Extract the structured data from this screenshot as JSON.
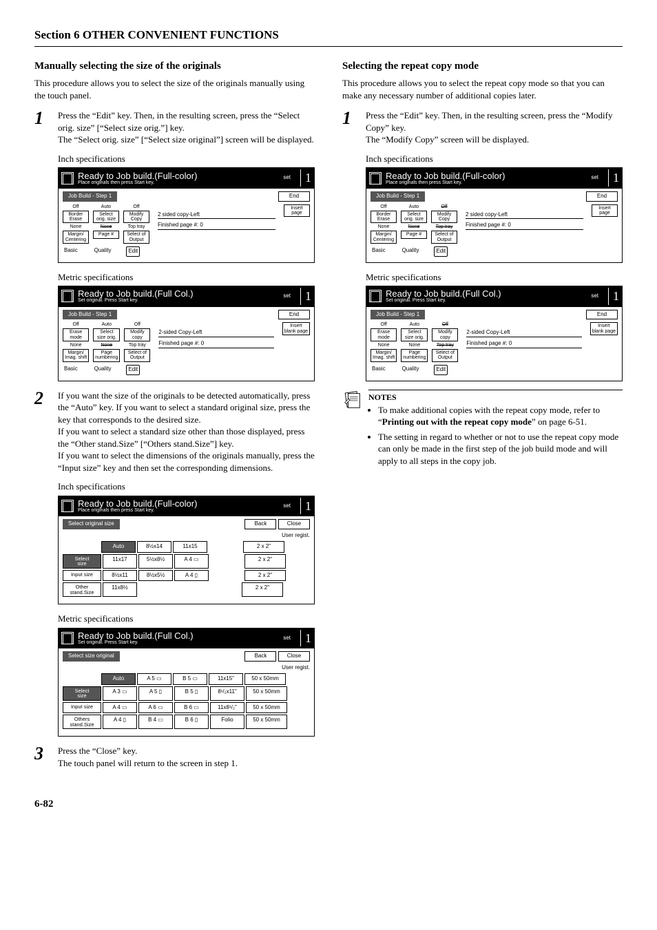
{
  "section_title": "Section 6  OTHER CONVENIENT FUNCTIONS",
  "page_number": "6-82",
  "speclabels": {
    "inch": "Inch specifications",
    "metric": "Metric specifications"
  },
  "panel_common": {
    "set": "set",
    "one": "1",
    "end": "End",
    "back": "Back",
    "close": "Close",
    "user_regist": "User regist."
  },
  "left": {
    "title": "Manually selecting the size of the originals",
    "intro": "This procedure allows you to select the size of the originals manually using the touch panel.",
    "step1": {
      "p1": "Press the “Edit” key. Then, in the resulting screen, press the “Select orig. size” [“Select size orig.”] key.",
      "p2": "The “Select orig. size” [“Select size original”] screen will be displayed."
    },
    "panel_inch": {
      "ready": "Ready to Job build.(Full-color)",
      "sub": "Place originals then press Start key.",
      "step": "Job Build -  Step 1",
      "insert": "Insert\npage",
      "status1": "2 sided copy-Left",
      "status2": "Finished page #: 0",
      "col1": {
        "v1": "Off",
        "b1": "Border\nErase",
        "v2": "None",
        "b2": "Margin/\nCentering"
      },
      "col2": {
        "v1": "Auto",
        "b1": "Select\norig. size",
        "v2": "None",
        "b2": "Page #"
      },
      "col3": {
        "v1": "Off",
        "b1": "Modify\nCopy",
        "v2": "Top tray",
        "b2": "Select of\nOutput"
      },
      "tabs": {
        "a": "Basic",
        "b": "Quality",
        "c": "Edit"
      }
    },
    "panel_metric": {
      "ready": "Ready to Job build.(Full Col.)",
      "sub": "Set original. Press Start key.",
      "step": "Job Build -  Step 1",
      "insert": "Insert\nblank page",
      "status1": "2-sided Copy-Left",
      "status2": "Finished page #: 0",
      "col1": {
        "v1": "Off",
        "b1": "Erase\nmode",
        "v2": "None",
        "b2": "Margin/\nImag. shift"
      },
      "col2": {
        "v1": "Auto",
        "b1": "Select\nsize orig.",
        "v2": "None",
        "b2": "Page\nnumbering"
      },
      "col3": {
        "v1": "Off",
        "b1": "Modify\ncopy",
        "v2": "Top tray",
        "b2": "Select of\nOutput"
      },
      "tabs": {
        "a": "Basic",
        "b": "Quality",
        "c": "Edit"
      }
    },
    "step2": {
      "p1": "If you want the size of the originals to be detected automatically, press the “Auto” key. If you want to select a standard original size, press the key that corresponds to the desired size.",
      "p2": "If you want to select a standard size other than those displayed, press the “Other stand.Size” [“Others stand.Size”] key.",
      "p3": "If you want to select the dimensions of the originals manually, press the “Input size” key and then set the corresponding dimensions."
    },
    "panel_size_inch": {
      "ready": "Ready to Job build.(Full-color)",
      "sub": "Place originals then press Start key.",
      "bar": "Select original size",
      "side": [
        "Select\nsize",
        "Input size",
        "Other\nstand.Size"
      ],
      "rows": [
        [
          "Auto",
          "8½x14",
          "11x15",
          "",
          "2 x 2\""
        ],
        [
          "11x17",
          "5½x8½",
          "A 4 ▭",
          "",
          "2 x 2\""
        ],
        [
          "8½x11",
          "8½x5½",
          "A 4 ▯",
          "",
          "2 x 2\""
        ],
        [
          "11x8½",
          "",
          "",
          "",
          "2 x 2\""
        ]
      ]
    },
    "panel_size_metric": {
      "ready": "Ready to Job build.(Full Col.)",
      "sub": "Set original. Press Start key.",
      "bar": "Select size original",
      "side": [
        "Select\nsize",
        "Input size",
        "Others\nstand.Size"
      ],
      "rows": [
        [
          "Auto",
          "A 5 ▭",
          "B 5 ▭",
          "11x15\"",
          "50 x 50mm"
        ],
        [
          "A 3 ▭",
          "A 5 ▯",
          "B 5 ▯",
          "8¹/₂x11\"",
          "50 x 50mm"
        ],
        [
          "A 4 ▭",
          "A 6 ▭",
          "B 6 ▭",
          "11x8¹/₂\"",
          "50 x 50mm"
        ],
        [
          "A 4 ▯",
          "B 4 ▭",
          "B 6 ▯",
          "Folio",
          "50 x 50mm"
        ]
      ]
    },
    "step3": {
      "p1": "Press the “Close” key.",
      "p2": "The touch panel will return to the screen in step 1."
    }
  },
  "right": {
    "title": "Selecting the repeat copy mode",
    "intro": "This procedure allows you to select the repeat copy mode so that you can make any necessary number of additional copies later.",
    "step1": {
      "p1": "Press the “Edit” key. Then, in the resulting screen, press the “Modify Copy” key.",
      "p2": "The “Modify Copy” screen will be displayed."
    },
    "panel_inch": {
      "ready": "Ready to Job build.(Full-color)",
      "sub": "Place originals then press Start key.",
      "step": "Job Build -  Step 1",
      "insert": "Insert\npage",
      "status1": "2 sided copy-Left",
      "status2": "Finished page #: 0",
      "col1": {
        "v1": "Off",
        "b1": "Border\nErase",
        "v2": "None",
        "b2": "Margin/\nCentering"
      },
      "col2": {
        "v1": "Auto",
        "b1": "Select\norig. size",
        "v2": "None",
        "b2": "Page #"
      },
      "col3": {
        "v1": "Off",
        "b1": "Modify\nCopy",
        "v2": "Top tray",
        "b2": "Select of\nOutput"
      },
      "tabs": {
        "a": "Basic",
        "b": "Quality",
        "c": "Edit"
      }
    },
    "panel_metric": {
      "ready": "Ready to Job build.(Full Col.)",
      "sub": "Set original. Press Start key.",
      "step": "Job Build -  Step 1",
      "insert": "Insert\nblank page",
      "status1": "2-sided Copy-Left",
      "status2": "Finished page #: 0",
      "col1": {
        "v1": "Off",
        "b1": "Erase\nmode",
        "v2": "None",
        "b2": "Margin/\nImag. shift"
      },
      "col2": {
        "v1": "Auto",
        "b1": "Select\nsize orig.",
        "v2": "None",
        "b2": "Page\nnumbering"
      },
      "col3": {
        "v1": "Off",
        "b1": "Modify\ncopy",
        "v2": "Top tray",
        "b2": "Select of\nOutput"
      },
      "tabs": {
        "a": "Basic",
        "b": "Quality",
        "c": "Edit"
      }
    },
    "notes": {
      "title": "NOTES",
      "item1_a": "To make additional copies with the repeat copy mode, refer to “",
      "item1_b": "Printing out with the repeat copy mode",
      "item1_c": "” on page 6-51.",
      "item2": "The setting in regard to whether or not to use the repeat copy mode can only be made in the first step of the job build mode and will apply to all steps in the copy job."
    }
  }
}
